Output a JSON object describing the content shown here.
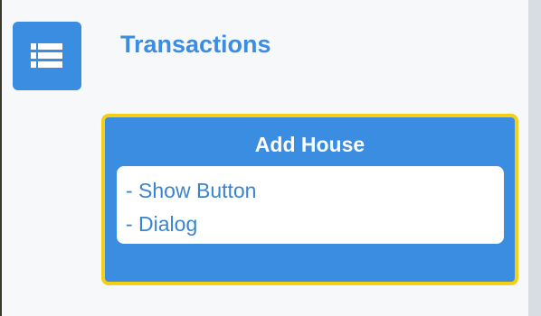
{
  "header": {
    "icon": "list-icon",
    "title": "Transactions"
  },
  "card": {
    "title": "Add House",
    "items": [
      "- Show Button",
      "- Dialog"
    ]
  },
  "colors": {
    "accent": "#3a8de0",
    "highlight_border": "#f6cf12",
    "text_blue": "#3a84cf",
    "background": "#f7f8fa"
  }
}
